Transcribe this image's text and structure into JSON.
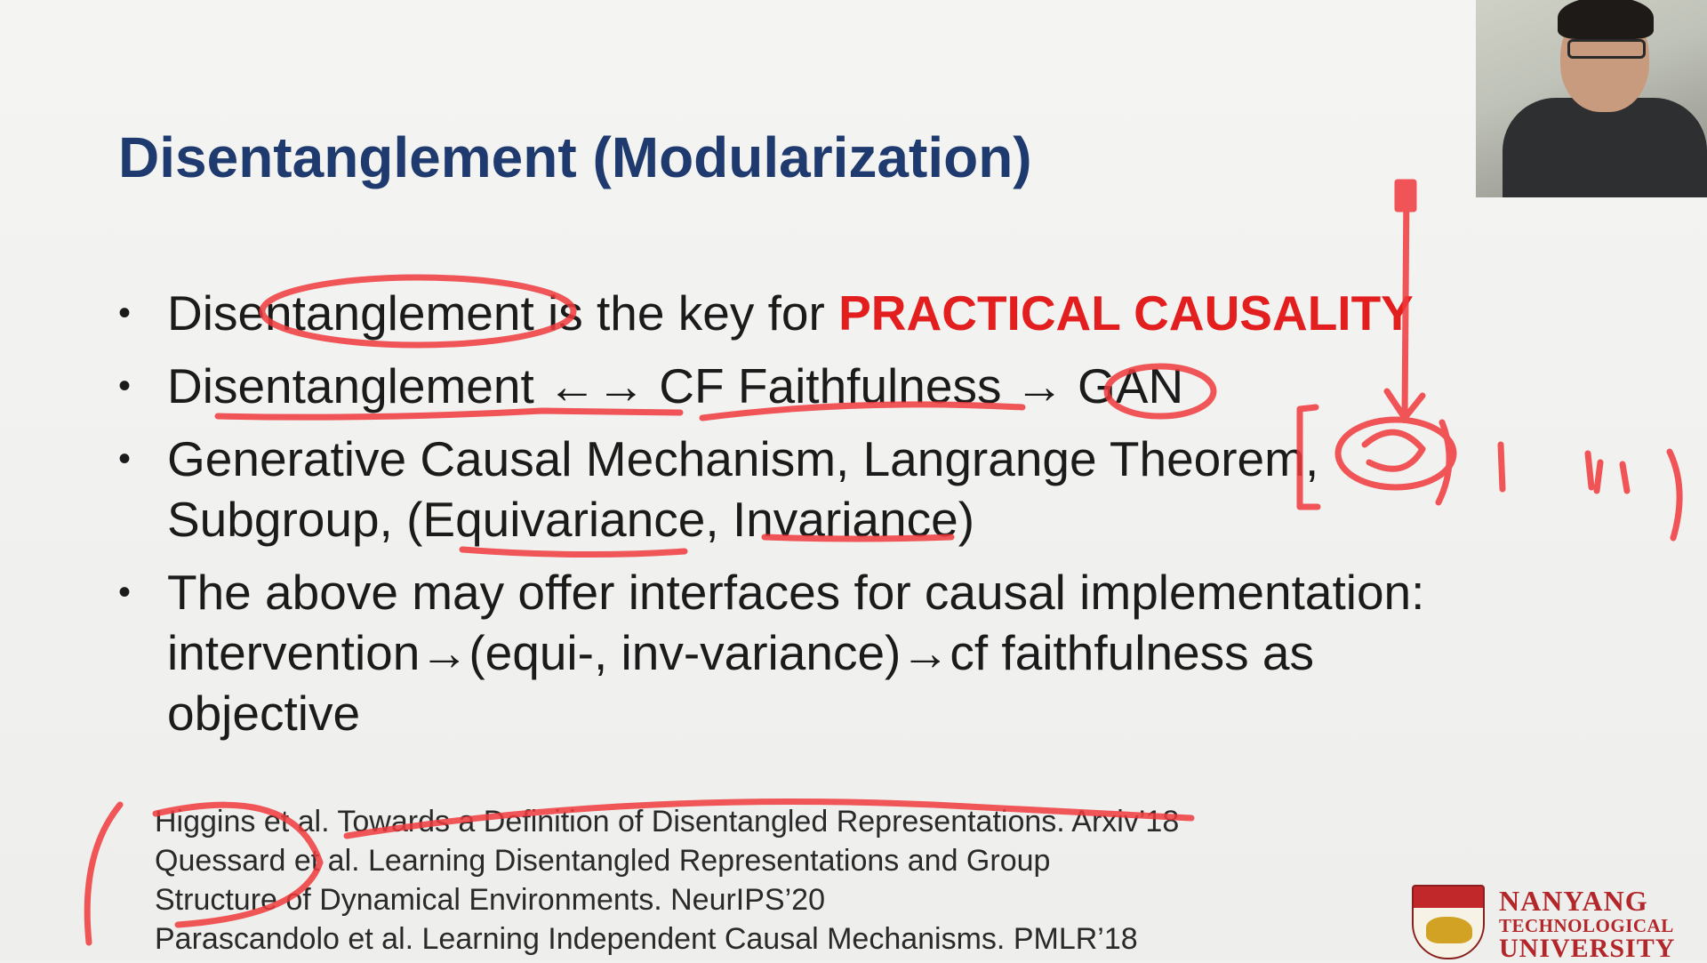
{
  "slide": {
    "title": "Disentanglement (Modularization)",
    "bullets": [
      {
        "pre": "Disentanglement is the key for ",
        "highlight": "PRACTICAL CAUSALITY"
      },
      {
        "pre": "Disentanglement ←→ CF Faithfulness → GAN",
        "highlight": ""
      },
      {
        "pre": "Generative Causal Mechanism, Langrange Theorem, Subgroup, (Equivariance, Invariance)",
        "highlight": ""
      },
      {
        "pre": "The above may offer interfaces for causal implementation: intervention→(equi-, inv-variance)→cf faithfulness as objective",
        "highlight": ""
      }
    ],
    "references": [
      "Higgins et al. Towards a Definition of Disentangled Representations. Arxiv’18",
      "Quessard et al. Learning Disentangled Representations and Group",
      "Structure of Dynamical Environments. NeurIPS’20",
      "Parascandolo et al. Learning Independent Causal Mechanisms. PMLR’18"
    ]
  },
  "logo": {
    "line1": "NANYANG",
    "line2": "TECHNOLOGICAL",
    "line3": "UNIVERSITY"
  },
  "colors": {
    "title": "#1f3a6e",
    "highlight": "#e31e1e",
    "ink": "#f0393c"
  }
}
